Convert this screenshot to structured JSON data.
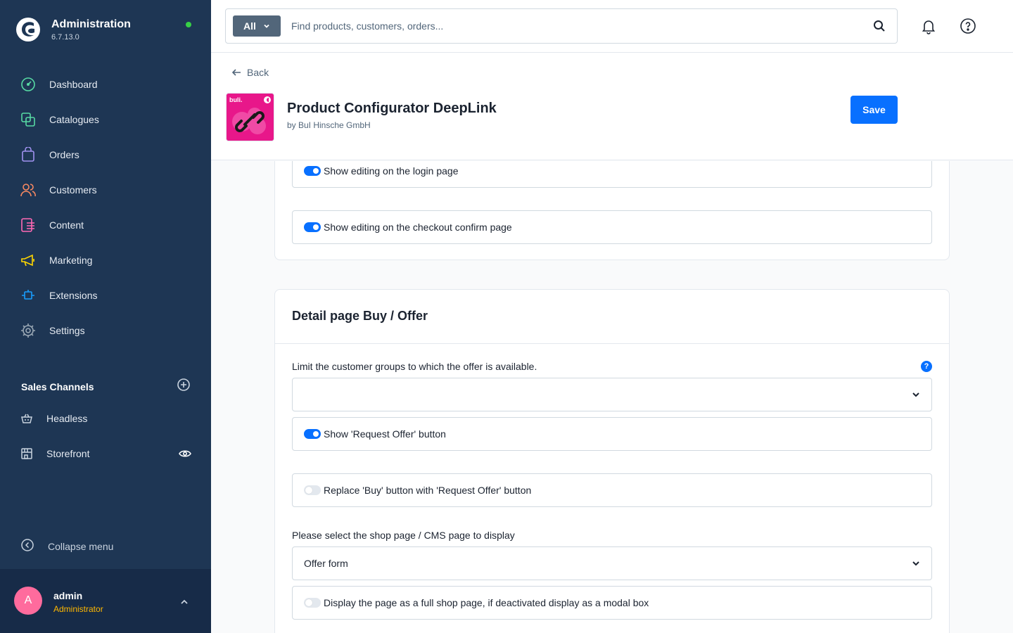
{
  "app": {
    "title": "Administration",
    "version": "6.7.13.0"
  },
  "nav": {
    "items": [
      {
        "label": "Dashboard",
        "icon": "dashboard-icon",
        "color": "#57d9a3"
      },
      {
        "label": "Catalogues",
        "icon": "catalogue-icon",
        "color": "#57d9a3"
      },
      {
        "label": "Orders",
        "icon": "orders-icon",
        "color": "#a092f0"
      },
      {
        "label": "Customers",
        "icon": "customers-icon",
        "color": "#f88962"
      },
      {
        "label": "Content",
        "icon": "content-icon",
        "color": "#ff68b4"
      },
      {
        "label": "Marketing",
        "icon": "marketing-icon",
        "color": "#ffd700"
      },
      {
        "label": "Extensions",
        "icon": "extensions-icon",
        "color": "#189eff"
      },
      {
        "label": "Settings",
        "icon": "settings-icon",
        "color": "#9aa8b5"
      }
    ]
  },
  "sales_channels": {
    "title": "Sales Channels",
    "items": [
      {
        "label": "Headless",
        "icon": "basket-icon"
      },
      {
        "label": "Storefront",
        "icon": "storefront-icon"
      }
    ]
  },
  "sidebar_footer": {
    "collapse_label": "Collapse menu",
    "user": {
      "initial": "A",
      "name": "admin",
      "role": "Administrator"
    }
  },
  "search": {
    "type_label": "All",
    "placeholder": "Find products, customers, orders..."
  },
  "smartbar": {
    "back_label": "Back",
    "plugin_title": "Product Configurator DeepLink",
    "plugin_vendor": "by BuI Hinsche GmbH",
    "plugin_logo_text": "buli.",
    "save_label": "Save"
  },
  "section_one": {
    "fields": [
      {
        "label": "Show editing on the login page",
        "enabled": true
      },
      {
        "label": "Show editing on the checkout confirm page",
        "enabled": true
      }
    ]
  },
  "section_two": {
    "title": "Detail page Buy / Offer",
    "customer_groups_label": "Limit the customer groups to which the offer is available.",
    "customer_groups_value": "",
    "help_glyph": "?",
    "request_offer_toggle": {
      "label": "Show 'Request Offer' button",
      "enabled": true
    },
    "replace_buy_toggle": {
      "label": "Replace 'Buy' button with 'Request Offer' button",
      "enabled": false
    },
    "cms_page_label": "Please select the shop page / CMS page to display",
    "cms_page_value": "Offer form",
    "full_page_toggle": {
      "label": "Display the page as a full shop page, if deactivated display as a modal box",
      "enabled": false
    }
  },
  "colors": {
    "sidebar": "#1e3654",
    "accent": "#0870ff",
    "status_online": "#37d046",
    "role": "#ffb800",
    "avatar": "#ff6b9d"
  }
}
